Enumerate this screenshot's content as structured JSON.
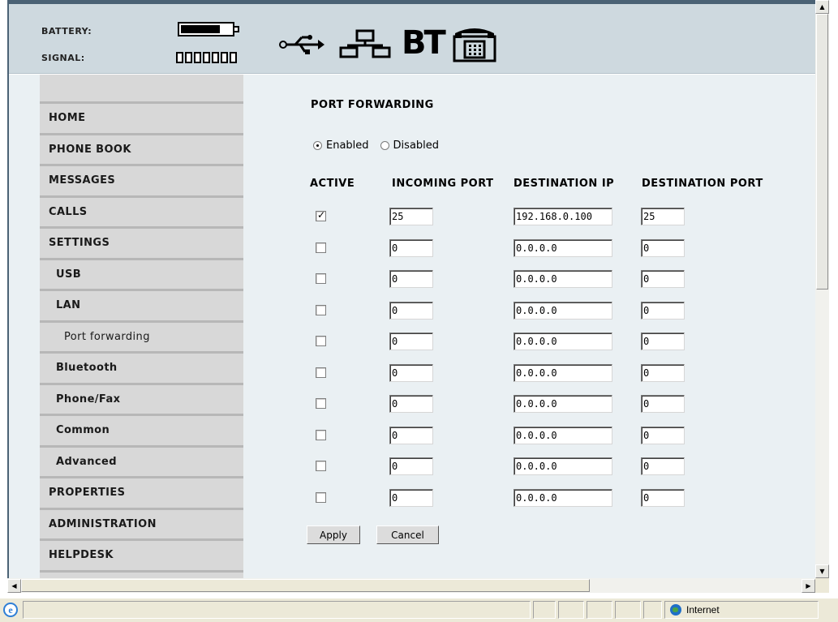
{
  "header": {
    "battery_label": "BATTERY:",
    "signal_label": "SIGNAL:",
    "battery_level": 0.78,
    "signal_bars": 0,
    "icons": [
      "usb-icon",
      "lan-icon",
      "bluetooth-icon",
      "phone-fax-icon"
    ],
    "bt_text": "BT"
  },
  "sidebar": {
    "items": [
      {
        "label": "HOME",
        "level": 0
      },
      {
        "label": "PHONE BOOK",
        "level": 0
      },
      {
        "label": "MESSAGES",
        "level": 0
      },
      {
        "label": "CALLS",
        "level": 0
      },
      {
        "label": "SETTINGS",
        "level": 0
      },
      {
        "label": "USB",
        "level": 1
      },
      {
        "label": "LAN",
        "level": 1
      },
      {
        "label": "Port forwarding",
        "level": 2
      },
      {
        "label": "Bluetooth",
        "level": 1
      },
      {
        "label": "Phone/Fax",
        "level": 1
      },
      {
        "label": "Common",
        "level": 1
      },
      {
        "label": "Advanced",
        "level": 1
      },
      {
        "label": "PROPERTIES",
        "level": 0
      },
      {
        "label": "ADMINISTRATION",
        "level": 0
      },
      {
        "label": "HELPDESK",
        "level": 0
      }
    ]
  },
  "main": {
    "title": "PORT FORWARDING",
    "mode": {
      "enabled_label": "Enabled",
      "disabled_label": "Disabled",
      "selected": "Enabled"
    },
    "columns": [
      "ACTIVE",
      "INCOMING PORT",
      "DESTINATION IP",
      "DESTINATION PORT"
    ],
    "rows": [
      {
        "active": true,
        "incoming_port": "25",
        "destination_ip": "192.168.0.100",
        "destination_port": "25"
      },
      {
        "active": false,
        "incoming_port": "0",
        "destination_ip": "0.0.0.0",
        "destination_port": "0"
      },
      {
        "active": false,
        "incoming_port": "0",
        "destination_ip": "0.0.0.0",
        "destination_port": "0"
      },
      {
        "active": false,
        "incoming_port": "0",
        "destination_ip": "0.0.0.0",
        "destination_port": "0"
      },
      {
        "active": false,
        "incoming_port": "0",
        "destination_ip": "0.0.0.0",
        "destination_port": "0"
      },
      {
        "active": false,
        "incoming_port": "0",
        "destination_ip": "0.0.0.0",
        "destination_port": "0"
      },
      {
        "active": false,
        "incoming_port": "0",
        "destination_ip": "0.0.0.0",
        "destination_port": "0"
      },
      {
        "active": false,
        "incoming_port": "0",
        "destination_ip": "0.0.0.0",
        "destination_port": "0"
      },
      {
        "active": false,
        "incoming_port": "0",
        "destination_ip": "0.0.0.0",
        "destination_port": "0"
      },
      {
        "active": false,
        "incoming_port": "0",
        "destination_ip": "0.0.0.0",
        "destination_port": "0"
      }
    ],
    "apply_label": "Apply",
    "cancel_label": "Cancel"
  },
  "statusbar": {
    "zone_label": "Internet"
  }
}
